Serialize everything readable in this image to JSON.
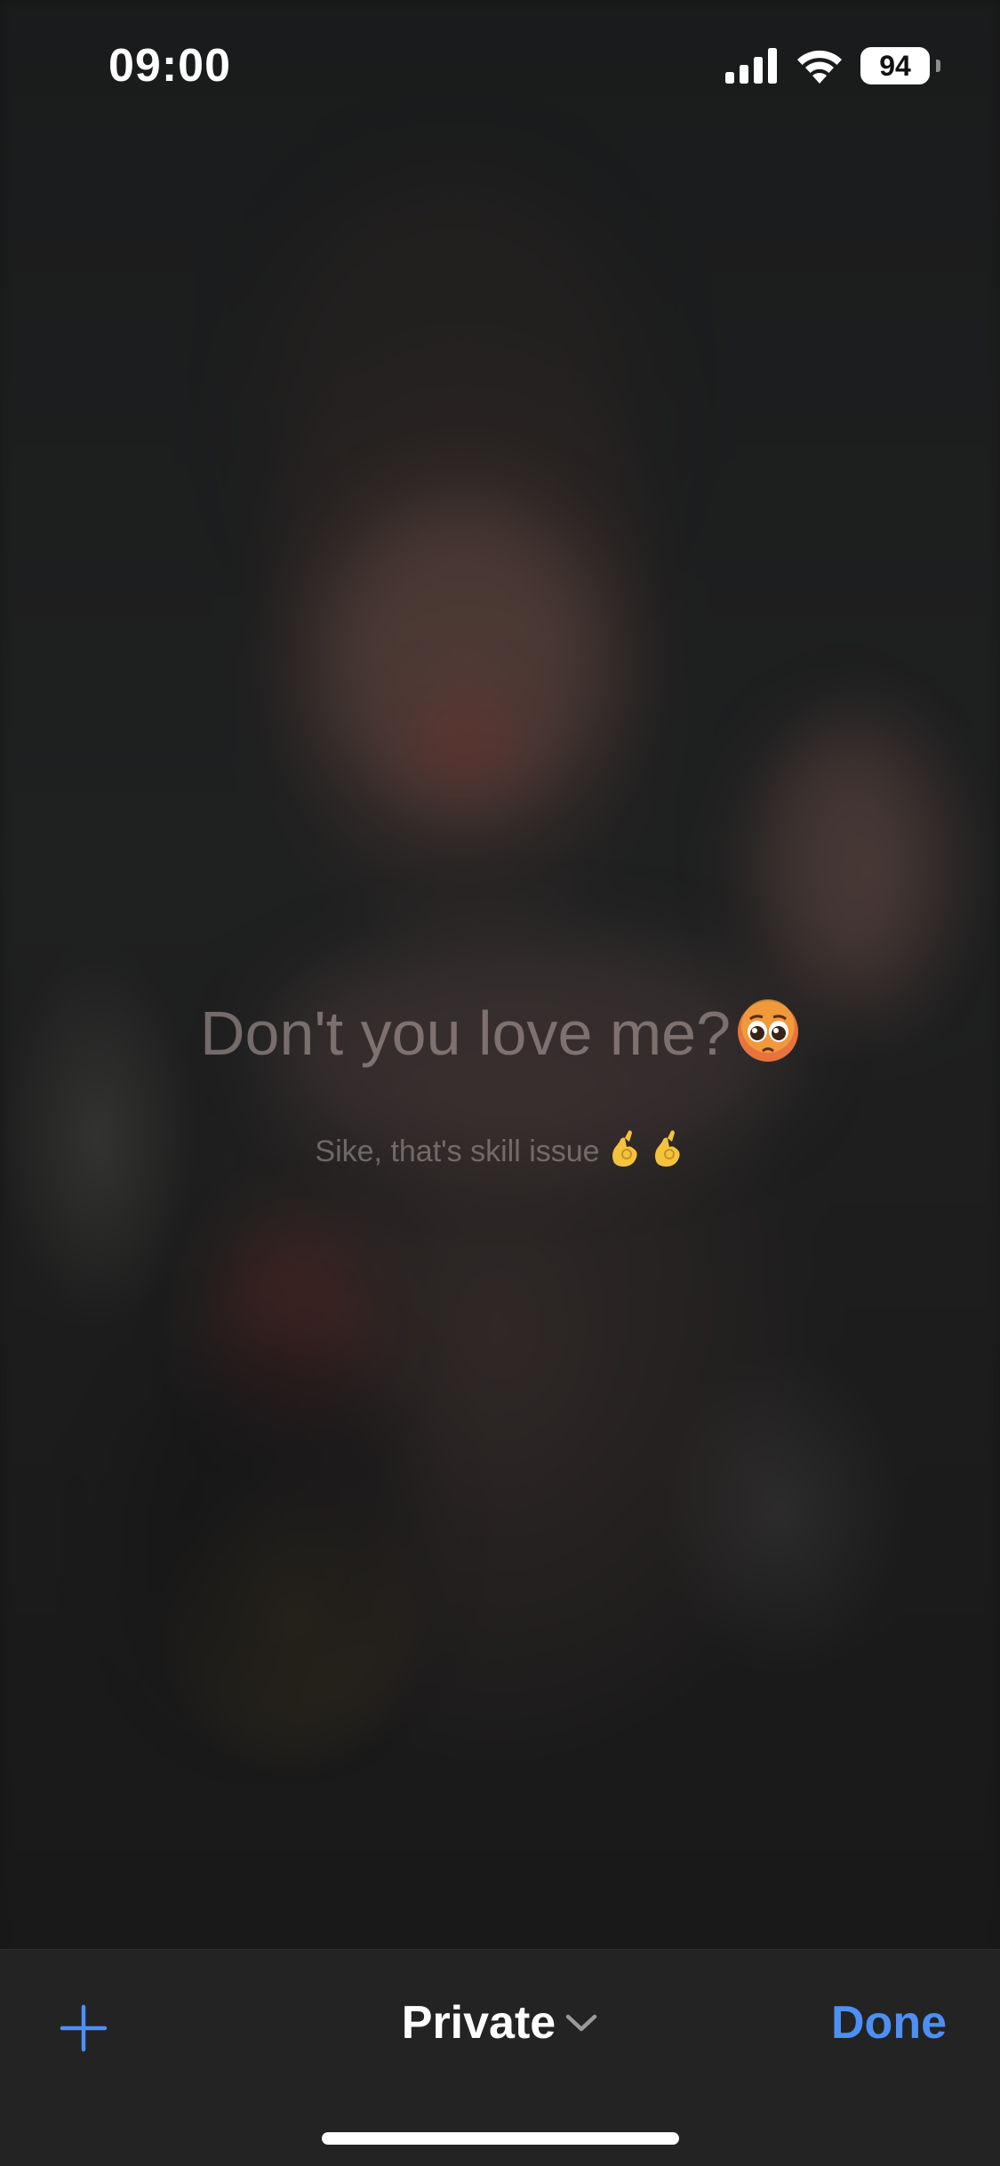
{
  "status_bar": {
    "time": "09:00",
    "battery_level": "94",
    "icons": [
      "cellular-signal-icon",
      "wifi-icon",
      "battery-icon"
    ]
  },
  "content": {
    "headline": "Don't you love me?",
    "headline_emoji": "pleading-face-emoji",
    "subline": "Sike, that's skill issue",
    "subline_emoji": [
      "ok-hand-emoji",
      "ok-hand-emoji"
    ]
  },
  "toolbar": {
    "add_icon": "plus-icon",
    "tab_group_label": "Private",
    "tab_group_icon": "chevron-down-icon",
    "done_label": "Done",
    "accent_color": "#4d8ff4"
  }
}
